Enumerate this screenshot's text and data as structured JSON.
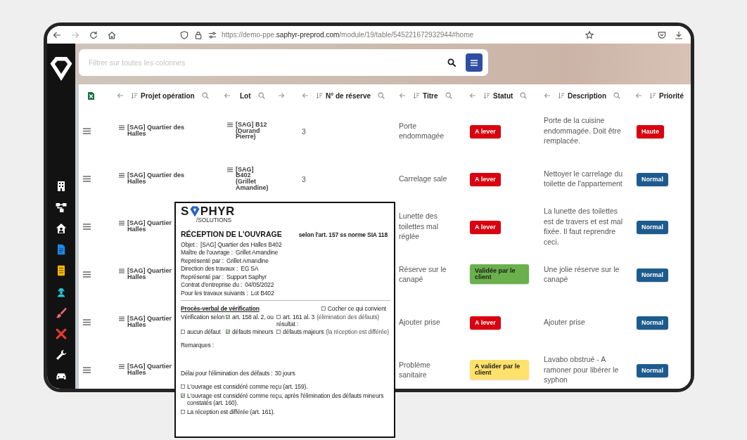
{
  "browser": {
    "url": "https://demo-ppe.**saphyr-preprod.com**/module/19/table/545221672932944#home",
    "forward_disabled": true
  },
  "search": {
    "placeholder": "Filtrer sur toutes les colonnes"
  },
  "table": {
    "columns": [
      {
        "label": "Projet opération",
        "sortable": true,
        "movable_right": false
      },
      {
        "label": "Lot",
        "sortable": false,
        "movable_right": true
      },
      {
        "label": "N° de réserve",
        "sortable": true,
        "movable_right": false
      },
      {
        "label": "Titre",
        "sortable": true,
        "movable_right": false
      },
      {
        "label": "Statut",
        "sortable": true,
        "movable_right": false
      },
      {
        "label": "Description",
        "sortable": true,
        "movable_right": false
      },
      {
        "label": "Priorité",
        "sortable": true,
        "movable_right": false
      }
    ],
    "rows": [
      {
        "project": "[SAG] Quartier des\nHalles",
        "lot": "[SAG] B12 (Durand Pierre)",
        "number": "3",
        "title": "Porte endommagée",
        "status": {
          "label": "A lever",
          "color": "#d9000f"
        },
        "description": "Porte de la cuisine endommagée. Doit être remplacée.",
        "priority": {
          "label": "Haute",
          "color": "#d9000f"
        }
      },
      {
        "project": "[SAG] Quartier des\nHalles",
        "lot": "[SAG] B402 (Grillet Amandine)",
        "number": "3",
        "title": "Carrelage sale",
        "status": {
          "label": "A lever",
          "color": "#d9000f"
        },
        "description": "Nettoyer le carrelage du toilette de l'appartement",
        "priority": {
          "label": "Normal",
          "color": "#1d5b8e"
        }
      },
      {
        "project": "[SAG] Quartier\nHalles",
        "title": "Lunette des toilettes mal réglée",
        "status": {
          "label": "A lever",
          "color": "#d9000f"
        },
        "description": "La lunette des toilettes est de travers et est mal fixée. Il faut reprendre ceci.",
        "priority": {
          "label": "Normal",
          "color": "#1d5b8e"
        }
      },
      {
        "project": "[SAG] Quartier\nHalles",
        "title": "Réserve sur le canapé",
        "status": {
          "label": "Validée par le client",
          "color": "#6ab04c"
        },
        "description": "Une jolie réserve sur le canapé",
        "priority": {
          "label": "Normal",
          "color": "#1d5b8e"
        }
      },
      {
        "project": "[SAG] Quartier\nHalles",
        "title": "Ajouter prise",
        "status": {
          "label": "A lever",
          "color": "#d9000f"
        },
        "description": "Ajouter prise",
        "priority": {
          "label": "Normal",
          "color": "#1d5b8e"
        }
      },
      {
        "project": "[SAG] Quartier\nHalles",
        "title": "Problème sanitaire",
        "status": {
          "label": "A valider par le client",
          "color": "#ffe16b"
        },
        "description": "Lavabo obstrué - A ramoner pour libérer le syphon",
        "priority": {
          "label": "Normal",
          "color": "#1d5b8e"
        }
      }
    ]
  },
  "document": {
    "logo": {
      "lead": "S",
      "rest": "PHYR",
      "tagline": "/SOLUTIONS"
    },
    "title": "RÉCEPTION DE L'OUVRAGE",
    "reference": "selon l'art. 157 ss norme SIA 118",
    "fields": [
      {
        "label": "Objet :",
        "value": "[SAG] Quartier des Halles B402"
      },
      {
        "label": "Maître de l'ouvrage :",
        "value": "Grillet Amandine"
      },
      {
        "label": "Représenté par :",
        "value": "Grillet Amandine"
      },
      {
        "label": "Direction des travaux :",
        "value": "EG SA"
      },
      {
        "label": "Représenté par :",
        "value": "Support Saphyr"
      },
      {
        "label": "Contrat d'entreprise du :",
        "value": "04/05/2022"
      },
      {
        "label": "Pour les travaux suivants :",
        "value": "Lot B402"
      }
    ],
    "section": "Procès-verbal de vérification",
    "instruction": {
      "label": "Cocher ce qui convient",
      "checked": false
    },
    "verification": [
      [
        {
          "kind": "text",
          "label": "Vérification selon"
        },
        {
          "kind": "checkbox",
          "label": "art. 158 al. 2, ou",
          "checked": true
        },
        {
          "kind": "checkbox",
          "label": "art. 161 al. 3",
          "note": "(élimination des défauts)",
          "suffix": "résultat :",
          "checked": false
        }
      ],
      [
        {
          "kind": "checkbox",
          "label": "aucun défaut",
          "checked": false
        },
        {
          "kind": "checkbox",
          "label": "défauts mineurs",
          "checked": true
        },
        {
          "kind": "checkbox",
          "label": "défauts majeurs",
          "note": "(la réception est différée)",
          "checked": false
        }
      ]
    ],
    "remarks": "Remarques :",
    "deadline": {
      "label": "Délai pour l'élimination des défauts :",
      "value": "30 jours"
    },
    "outcomes": [
      {
        "label": "L'ouvrage est considéré comme reçu (art. 159).",
        "checked": false
      },
      {
        "label": "L'ouvrage est considéré comme reçu, après l'élimination des défauts mineurs constatés (art. 160).",
        "checked": true
      },
      {
        "label": "La réception est différée (art. 161).",
        "checked": false
      }
    ]
  }
}
